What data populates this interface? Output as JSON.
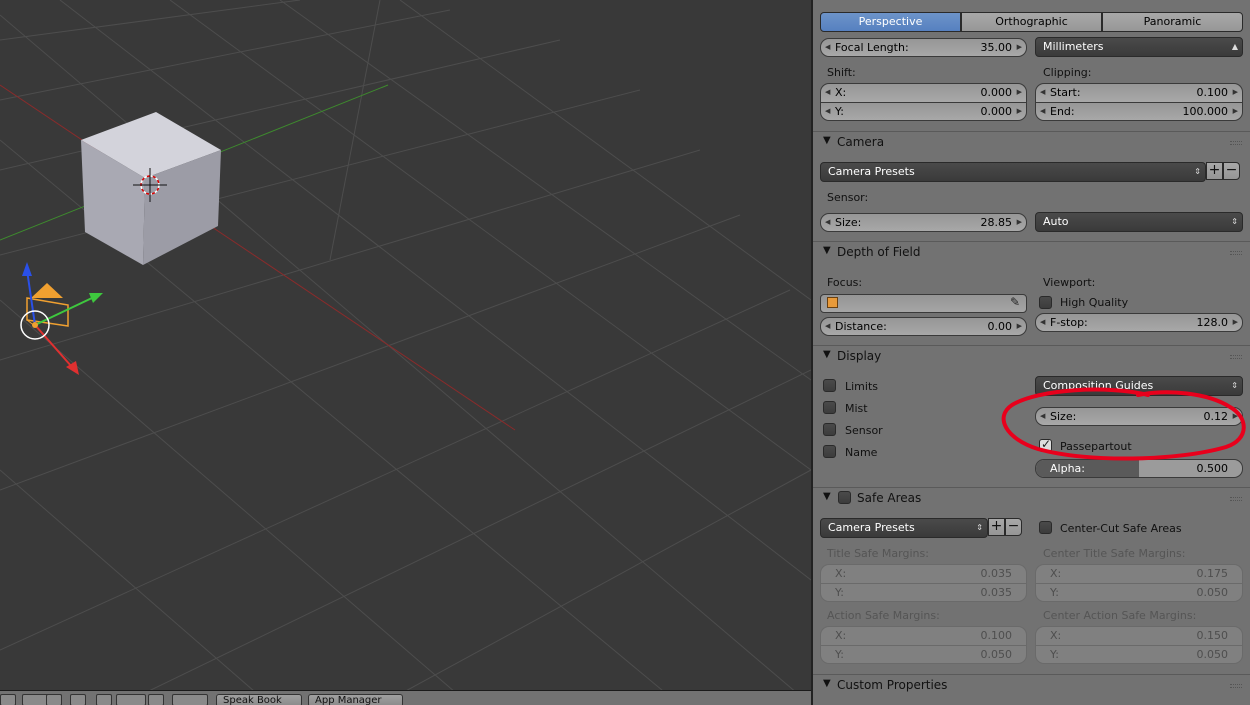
{
  "projection_tabs": [
    {
      "label": "Perspective",
      "selected": true
    },
    {
      "label": "Orthographic",
      "selected": false
    },
    {
      "label": "Panoramic",
      "selected": false
    }
  ],
  "lens": {
    "focal_label": "Focal Length:",
    "focal_value": "35.00",
    "unit": "Millimeters",
    "shift_label": "Shift:",
    "shift_x_label": "X:",
    "shift_x": "0.000",
    "shift_y_label": "Y:",
    "shift_y": "0.000",
    "clip_label": "Clipping:",
    "clip_start_label": "Start:",
    "clip_start": "0.100",
    "clip_end_label": "End:",
    "clip_end": "100.000"
  },
  "camera": {
    "header": "Camera",
    "presets": "Camera Presets",
    "sensor_label": "Sensor:",
    "size_label": "Size:",
    "size_value": "28.85",
    "fit": "Auto"
  },
  "dof": {
    "header": "Depth of Field",
    "focus_label": "Focus:",
    "distance_label": "Distance:",
    "distance_value": "0.00",
    "viewport_label": "Viewport:",
    "high_quality": "High Quality",
    "fstop_label": "F-stop:",
    "fstop_value": "128.0"
  },
  "display": {
    "header": "Display",
    "checks": [
      {
        "label": "Limits",
        "checked": false
      },
      {
        "label": "Mist",
        "checked": false
      },
      {
        "label": "Sensor",
        "checked": false
      },
      {
        "label": "Name",
        "checked": false
      }
    ],
    "guides": "Composition Guides",
    "size_label": "Size:",
    "size_value": "0.12",
    "passepartout": "Passepartout",
    "alpha_label": "Alpha:",
    "alpha_value": "0.500",
    "alpha_fraction": 0.5
  },
  "safe_areas": {
    "header": "Safe Areas",
    "presets": "Camera Presets",
    "center_cut": "Center-Cut Safe Areas",
    "title_label": "Title Safe Margins:",
    "title_x": "0.035",
    "title_y": "0.035",
    "center_title_label": "Center Title Safe Margins:",
    "center_title_x": "0.175",
    "center_title_y": "0.050",
    "action_label": "Action Safe Margins:",
    "action_x": "0.100",
    "action_y": "0.050",
    "center_action_label": "Center Action Safe Margins:",
    "center_action_x": "0.150",
    "center_action_y": "0.050",
    "x_label": "X:",
    "y_label": "Y:"
  },
  "custom_properties": {
    "header": "Custom Properties"
  },
  "bottom_bar": {
    "speak_book": "Speak Book",
    "app_manager": "App Manager"
  },
  "colors": {
    "accent": "#5680c0",
    "annotation": "#e8001c",
    "panel": "#727272",
    "viewport": "#393939"
  }
}
